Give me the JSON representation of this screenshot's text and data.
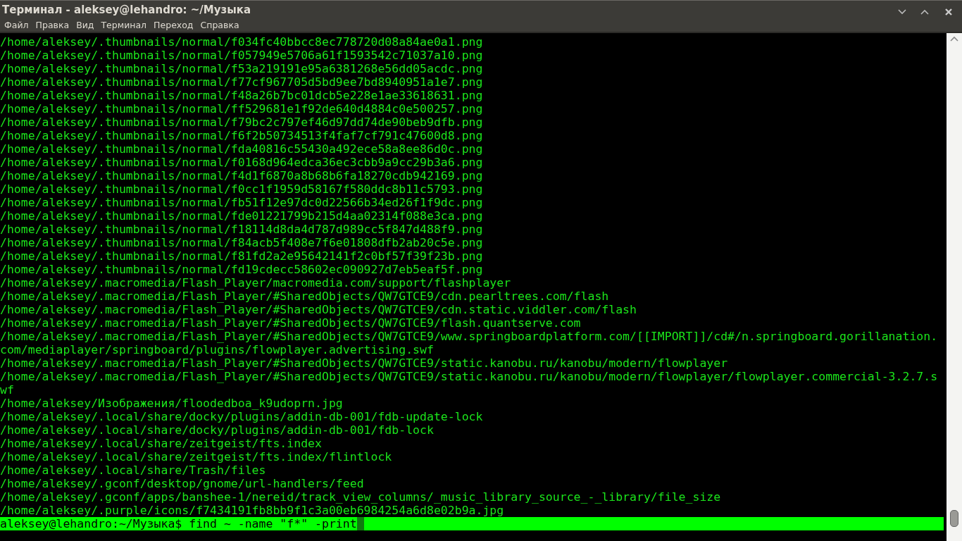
{
  "window": {
    "title": "Терминал - aleksey@lehandro: ~/Музыка"
  },
  "menu": [
    {
      "label": "Файл"
    },
    {
      "label": "Правка"
    },
    {
      "label": "Вид"
    },
    {
      "label": "Терминал"
    },
    {
      "label": "Переход"
    },
    {
      "label": "Справка"
    }
  ],
  "output_rows": [
    "/home/aleksey/.thumbnails/normal/f034fc40bbcc8ec778720d08a84ae0a1.png",
    "/home/aleksey/.thumbnails/normal/f057949e5706a61f1593542c71037a10.png",
    "/home/aleksey/.thumbnails/normal/f53a219191e95a6381268e56dd05acdc.png",
    "/home/aleksey/.thumbnails/normal/f77cf967705d5bd9ee7bd8940951a1e7.png",
    "/home/aleksey/.thumbnails/normal/f48a26b7bc01dcb5e228e1ae33618631.png",
    "/home/aleksey/.thumbnails/normal/ff529681e1f92de640d4884c0e500257.png",
    "/home/aleksey/.thumbnails/normal/f79bc2c797ef46d97dd74de90beb9dfb.png",
    "/home/aleksey/.thumbnails/normal/f6f2b50734513f4faf7cf791c47600d8.png",
    "/home/aleksey/.thumbnails/normal/fda40816c55430a492ece58a8ee86d0c.png",
    "/home/aleksey/.thumbnails/normal/f0168d964edca36ec3cbb9a9cc29b3a6.png",
    "/home/aleksey/.thumbnails/normal/f4d1f6870a8b68b6fa18270cdb942169.png",
    "/home/aleksey/.thumbnails/normal/f0cc1f1959d58167f580ddc8b11c5793.png",
    "/home/aleksey/.thumbnails/normal/fb51f12e97dc0d22566b34ed26f1f9dc.png",
    "/home/aleksey/.thumbnails/normal/fde01221799b215d4aa02314f088e3ca.png",
    "/home/aleksey/.thumbnails/normal/f18114d8da4d787d989cc5f847d488f9.png",
    "/home/aleksey/.thumbnails/normal/f84acb5f408e7f6e01808dfb2ab20c5e.png",
    "/home/aleksey/.thumbnails/normal/f81fd2a2e95642141f2c0bf57f39f23b.png",
    "/home/aleksey/.thumbnails/normal/fd19cdecc58602ec090927d7eb5eaf5f.png",
    "/home/aleksey/.macromedia/Flash_Player/macromedia.com/support/flashplayer",
    "/home/aleksey/.macromedia/Flash_Player/#SharedObjects/QW7GTCE9/cdn.pearltrees.com/flash",
    "/home/aleksey/.macromedia/Flash_Player/#SharedObjects/QW7GTCE9/cdn.static.viddler.com/flash",
    "/home/aleksey/.macromedia/Flash_Player/#SharedObjects/QW7GTCE9/flash.quantserve.com",
    "/home/aleksey/.macromedia/Flash_Player/#SharedObjects/QW7GTCE9/www.springboardplatform.com/[[IMPORT]]/cd#/n.springboard.gorillanation.",
    "com/mediaplayer/springboard/plugins/flowplayer.advertising.swf",
    "/home/aleksey/.macromedia/Flash_Player/#SharedObjects/QW7GTCE9/static.kanobu.ru/kanobu/modern/flowplayer",
    "/home/aleksey/.macromedia/Flash_Player/#SharedObjects/QW7GTCE9/static.kanobu.ru/kanobu/modern/flowplayer/flowplayer.commercial-3.2.7.s",
    "wf",
    "/home/aleksey/Изображения/floodedboa_k9udoprn.jpg",
    "/home/aleksey/.local/share/docky/plugins/addin-db-001/fdb-update-lock",
    "/home/aleksey/.local/share/docky/plugins/addin-db-001/fdb-lock",
    "/home/aleksey/.local/share/zeitgeist/fts.index",
    "/home/aleksey/.local/share/zeitgeist/fts.index/flintlock",
    "/home/aleksey/.local/share/Trash/files",
    "/home/aleksey/.gconf/desktop/gnome/url-handlers/feed",
    "/home/aleksey/.gconf/apps/banshee-1/nereid/track_view_columns/_music_library_source_-_library/file_size",
    "/home/aleksey/.purple/icons/f7434191fb8bb9f1c3a00eb6984254a6d8e02b9a.jpg"
  ],
  "prompt": {
    "text": "aleksey@lehandro:~/Музыка$ find ~ -name \"f*\" -print",
    "highlighted": true
  }
}
